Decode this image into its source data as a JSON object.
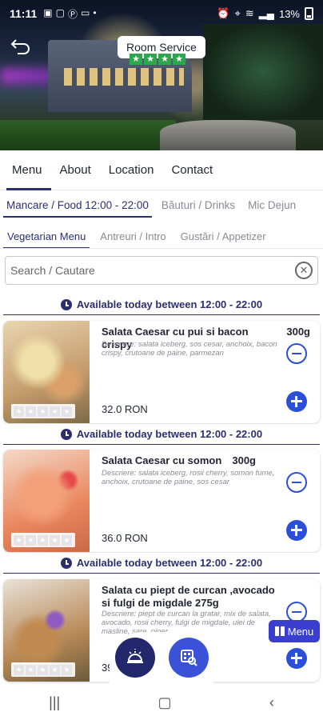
{
  "status_bar": {
    "time": "11:11",
    "left_icons": [
      "image-icon",
      "photo-icon",
      "pay-icon",
      "laptop-icon",
      "dot-icon"
    ],
    "right_icons": [
      "alarm-icon",
      "location-icon",
      "wifi-icon",
      "signal-icon",
      "signal-icon"
    ],
    "battery": "13%"
  },
  "header": {
    "title": "Room Service",
    "stars": [
      "★",
      "★",
      "★",
      "★"
    ],
    "star_color": "#2ba84a"
  },
  "nav": {
    "tabs": [
      {
        "label": "Menu",
        "active": true
      },
      {
        "label": "About",
        "active": false
      },
      {
        "label": "Location",
        "active": false
      },
      {
        "label": "Contact",
        "active": false
      }
    ]
  },
  "categories": [
    {
      "label": "Mancare / Food  12:00 - 22:00",
      "active": true
    },
    {
      "label": "Băuturi / Drinks",
      "active": false
    },
    {
      "label": "Mic Dejun",
      "active": false
    }
  ],
  "sub_categories": [
    {
      "label": "Vegetarian Menu",
      "active": true
    },
    {
      "label": "Antreuri / Intro",
      "active": false
    },
    {
      "label": "Gustări  / Appetizer",
      "active": false
    }
  ],
  "search": {
    "placeholder": "Search / Cautare",
    "value": ""
  },
  "availability_text": "Available today between 12:00 - 22:00",
  "items": [
    {
      "name": "Salata Caesar cu pui si bacon crispy",
      "weight": "300g",
      "description": "Descriere: salata iceberg, sos cesar, anchoix, bacon crispy, crutoane de paine, parmezan",
      "price": "32.0 RON",
      "has_minus": true
    },
    {
      "name": "Salata Caesar cu somon",
      "weight": "300g",
      "description": "Descriere: salata iceberg, rosii cherry, somon fume, anchoix, crutoane de paine, sos cesar",
      "price": "36.0 RON",
      "has_minus": true
    },
    {
      "name": "Salata cu piept de curcan ,avocado si fulgi de migdale",
      "weight": "275g",
      "description": "Descriere: piept de curcan la gratar, mix de salata, avocado, rosii cherry, fulgi de migdale, ulei de masline, sare, piper",
      "price": "39",
      "has_minus": true
    }
  ],
  "floating": {
    "menu_label": "Menu"
  },
  "colors": {
    "primary": "#2b2f6e",
    "accent": "#2b4fd8"
  }
}
